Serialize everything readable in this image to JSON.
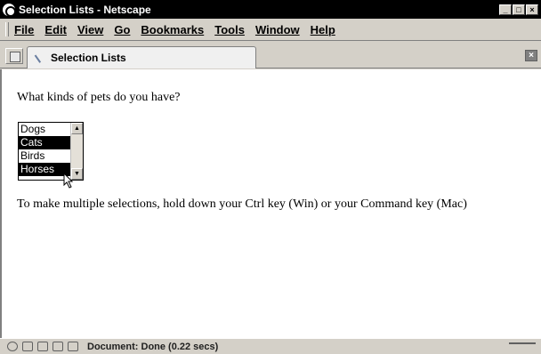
{
  "window": {
    "title": "Selection Lists - Netscape",
    "buttons": [
      "_",
      "□",
      "×"
    ]
  },
  "menubar": {
    "items": [
      "File",
      "Edit",
      "View",
      "Go",
      "Bookmarks",
      "Tools",
      "Window",
      "Help"
    ]
  },
  "tabs": {
    "active_label": "Selection Lists",
    "close_symbol": "×"
  },
  "page": {
    "question": "What kinds of pets do you have?",
    "listbox": {
      "options": [
        {
          "label": "Dogs",
          "selected": false
        },
        {
          "label": "Cats",
          "selected": true
        },
        {
          "label": "Birds",
          "selected": false
        },
        {
          "label": "Horses",
          "selected": true
        }
      ]
    },
    "instructions": "To make multiple selections, hold down your Ctrl key (Win) or your Command key (Mac)"
  },
  "status": {
    "text": "Document: Done (0.22 secs)"
  }
}
